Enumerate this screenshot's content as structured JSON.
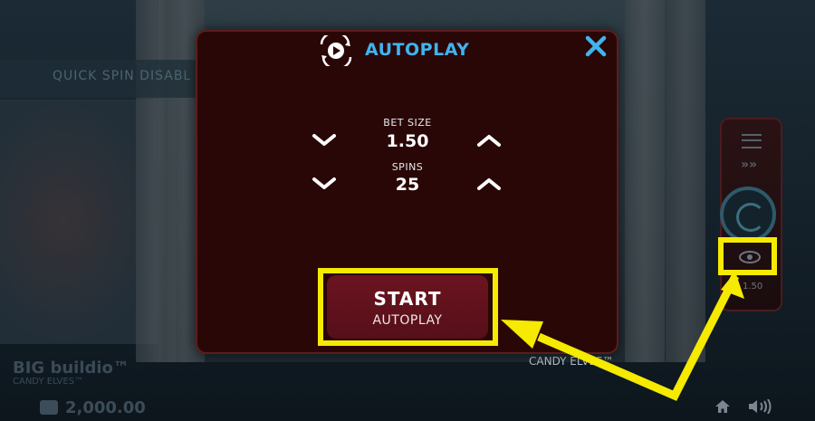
{
  "background": {
    "banner_text": "QUICK SPIN DISABL",
    "logo_big": "BIG buildio™",
    "logo_small": "CANDY ELVES™",
    "balance": "2,000.00",
    "game_name": "CANDY ELVES™",
    "right_panel_bet": "1.50"
  },
  "modal": {
    "title": "AUTOPLAY",
    "icon": "autoplay-icon",
    "close_icon": "close-icon",
    "bet_size": {
      "label": "BET SIZE",
      "value": "1.50"
    },
    "spins": {
      "label": "SPINS",
      "value": "25"
    },
    "start_button": {
      "main": "START",
      "sub": "AUTOPLAY"
    }
  },
  "colors": {
    "modal_bg": "#2a0707",
    "title_blue": "#3fb4ef",
    "button_red": "#6b1420",
    "highlight_yellow": "#f5ea00"
  }
}
